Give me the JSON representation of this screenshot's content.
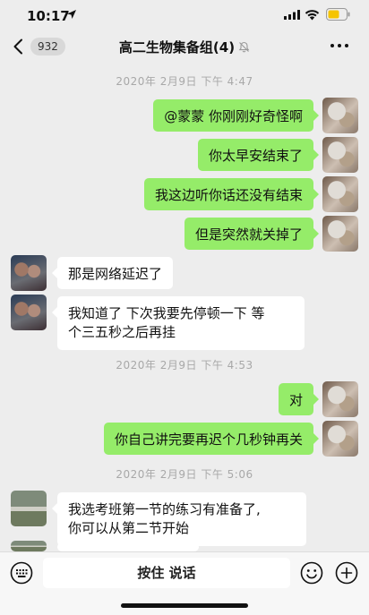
{
  "status_bar": {
    "time": "10:17"
  },
  "nav": {
    "unread_count": "932",
    "title": "高二生物集备组(4)"
  },
  "messages": {
    "ts1": "2020年 2月9日 下午 4:47",
    "m1": "@蒙蒙 你刚刚好奇怪啊",
    "m2": "你太早安结束了",
    "m3": "我这边听你话还没有结束",
    "m4": "但是突然就关掉了",
    "m5": "那是网络延迟了",
    "m6_line1": "我知道了 下次我要先停顿一下 等",
    "m6_line2": "个三五秒之后再挂",
    "ts2": "2020年 2月9日 下午 4:53",
    "m7": "对",
    "m8": "你自己讲完要再迟个几秒钟再关",
    "ts3": "2020年 2月9日 下午 5:06",
    "m9_line1": "我选考班第一节的练习有准备了,",
    "m9_line2": "你可以从第二节开始"
  },
  "input_bar": {
    "hold_to_talk": "按住 说话"
  },
  "colors": {
    "sent_bubble": "#95ec69",
    "received_bubble": "#ffffff",
    "background": "#ededed"
  }
}
